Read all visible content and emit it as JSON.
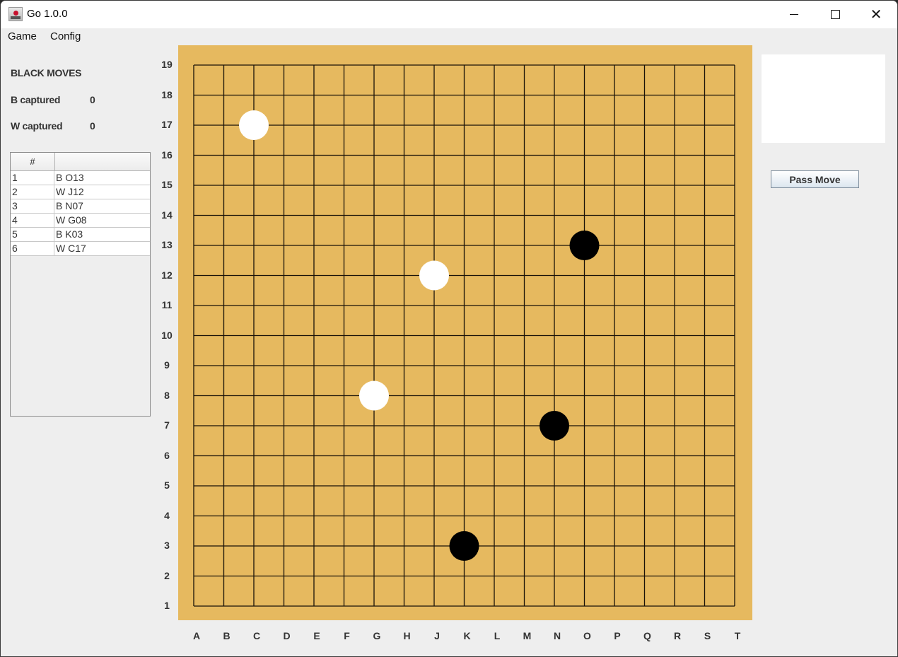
{
  "window": {
    "title": "Go 1.0.0",
    "controls": {
      "minimize": "minimize",
      "maximize": "maximize",
      "close": "close"
    }
  },
  "menu": {
    "items": [
      {
        "label": "Game"
      },
      {
        "label": "Config"
      }
    ]
  },
  "status": {
    "turn": "BLACK MOVES",
    "b_captured_label": "B captured",
    "b_captured_value": "0",
    "w_captured_label": "W captured",
    "w_captured_value": "0"
  },
  "move_table": {
    "headers": [
      "#",
      ""
    ],
    "rows": [
      {
        "num": "1",
        "move": "B O13"
      },
      {
        "num": "2",
        "move": "W J12"
      },
      {
        "num": "3",
        "move": "B N07"
      },
      {
        "num": "4",
        "move": "W G08"
      },
      {
        "num": "5",
        "move": "B K03"
      },
      {
        "num": "6",
        "move": "W C17"
      }
    ]
  },
  "board": {
    "size": 19,
    "columns": [
      "A",
      "B",
      "C",
      "D",
      "E",
      "F",
      "G",
      "H",
      "J",
      "K",
      "L",
      "M",
      "N",
      "O",
      "P",
      "Q",
      "R",
      "S",
      "T"
    ],
    "rows": [
      "19",
      "18",
      "17",
      "16",
      "15",
      "14",
      "13",
      "12",
      "11",
      "10",
      "9",
      "8",
      "7",
      "6",
      "5",
      "4",
      "3",
      "2",
      "1"
    ],
    "colors": {
      "wood": "#e6b95f",
      "line": "#1a1208",
      "black": "#000000",
      "white": "#ffffff"
    },
    "stones": [
      {
        "color": "black",
        "coord": "O13"
      },
      {
        "color": "white",
        "coord": "J12"
      },
      {
        "color": "black",
        "coord": "N7"
      },
      {
        "color": "white",
        "coord": "G8"
      },
      {
        "color": "black",
        "coord": "K3"
      },
      {
        "color": "white",
        "coord": "C17"
      }
    ]
  },
  "side_panel": {
    "pass_button_label": "Pass Move"
  }
}
